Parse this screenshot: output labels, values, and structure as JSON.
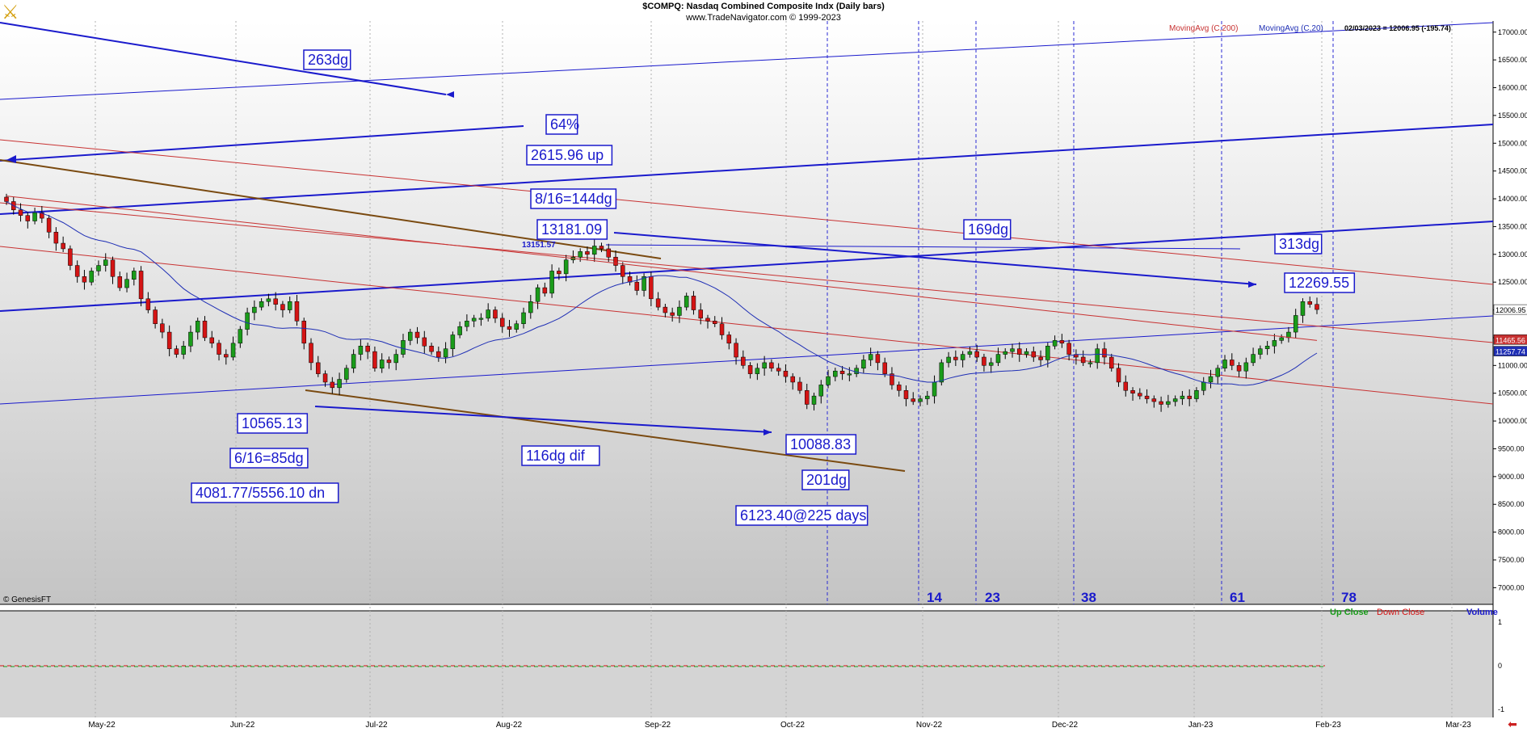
{
  "header": {
    "title": "$COMPQ:  Nasdaq Combined Composite Indx  (Daily bars)",
    "subtitle": "www.TradeNavigator.com © 1999-2023"
  },
  "indicator_legend": {
    "ma200_label": "MovingAvg (C,200)",
    "ma20_label": "MovingAvg (C,20)",
    "quote": "02/03/2023 = 12006.95 (-195.74)"
  },
  "watermark": "© GenesisFT",
  "volume_legend": {
    "up": "Up Close",
    "down": "Down Close",
    "volume": "Volume"
  },
  "colors": {
    "up": "#1a9c1a",
    "down": "#d41414",
    "ma20": "#1f2fb5",
    "ma200": "#c83232",
    "annotation": "#1a1acc",
    "brown": "#7a4a10",
    "panel_bg": "#d4d4d4"
  },
  "chart_data": {
    "type": "candlestick",
    "title": "$COMPQ:  Nasdaq Combined Composite Indx  (Daily bars)",
    "ylim": [
      6700,
      17200
    ],
    "price_ticks": [
      "17000.00",
      "16500.00",
      "16000.00",
      "15500.00",
      "15000.00",
      "14500.00",
      "14000.00",
      "13500.00",
      "13000.00",
      "12500.00",
      "12000.00",
      "11500.00",
      "11000.00",
      "10500.00",
      "10000.00",
      "9500.00",
      "9000.00",
      "8500.00",
      "8000.00",
      "7500.00",
      "7000.00"
    ],
    "x_ticks": [
      "May-22",
      "Jun-22",
      "Jul-22",
      "Aug-22",
      "Sep-22",
      "Oct-22",
      "Nov-22",
      "Dec-22",
      "Jan-23",
      "Feb-23",
      "Mar-23"
    ],
    "price_tags": [
      {
        "label": "12006.95",
        "value": 12006.95,
        "color": "#000000",
        "bg": "#ffffff"
      },
      {
        "label": "11465.56",
        "value": 11465.56,
        "color": "#ffffff",
        "bg": "#c83232"
      },
      {
        "label": "11257.74",
        "value": 11257.74,
        "color": "#ffffff",
        "bg": "#1f2fb5"
      }
    ],
    "volume_axis_ticks": [
      "1",
      "0",
      "-1"
    ],
    "candles_close_path": [
      13950,
      13800,
      13700,
      13600,
      13750,
      13650,
      13400,
      13200,
      13100,
      12800,
      12600,
      12500,
      12700,
      12800,
      12900,
      12600,
      12400,
      12550,
      12700,
      12200,
      12000,
      11750,
      11600,
      11300,
      11200,
      11350,
      11600,
      11800,
      11500,
      11400,
      11200,
      11150,
      11400,
      11650,
      11950,
      12050,
      12150,
      12200,
      12100,
      12000,
      12150,
      11800,
      11400,
      11050,
      10850,
      10700,
      10600,
      10750,
      10950,
      11200,
      11350,
      11250,
      10950,
      11100,
      11050,
      11200,
      11450,
      11600,
      11500,
      11350,
      11250,
      11150,
      11300,
      11550,
      11700,
      11800,
      11850,
      11850,
      12000,
      11850,
      11700,
      11650,
      11750,
      11950,
      12150,
      12400,
      12300,
      12700,
      12650,
      12900,
      12950,
      13050,
      13000,
      13150,
      13100,
      12950,
      12800,
      12600,
      12500,
      12350,
      12600,
      12200,
      12050,
      11950,
      11900,
      12050,
      12250,
      12000,
      11850,
      11800,
      11750,
      11550,
      11400,
      11150,
      11000,
      10850,
      10950,
      11050,
      10950,
      10900,
      10800,
      10700,
      10550,
      10300,
      10450,
      10650,
      10800,
      10900,
      10850,
      10850,
      10950,
      11100,
      11200,
      11050,
      10850,
      10650,
      10550,
      10400,
      10350,
      10400,
      10450,
      10700,
      11050,
      11150,
      11100,
      11200,
      11250,
      11150,
      11000,
      11050,
      11200,
      11250,
      11300,
      11200,
      11250,
      11150,
      11100,
      11350,
      11450,
      11400,
      11200,
      11150,
      11050,
      11050,
      11300,
      11150,
      10950,
      10700,
      10550,
      10500,
      10450,
      10400,
      10350,
      10300,
      10350,
      10400,
      10450,
      10400,
      10550,
      10700,
      10800,
      10950,
      11100,
      11000,
      10900,
      11050,
      11200,
      11300,
      11350,
      11450,
      11500,
      11600,
      11900,
      12150,
      12100,
      12006.95
    ],
    "series": [
      {
        "name": "MovingAvg (C,20)",
        "type": "line"
      },
      {
        "name": "MovingAvg (C,200)",
        "type": "line"
      }
    ],
    "annotations": [
      {
        "text": "263dg"
      },
      {
        "text": "64%"
      },
      {
        "text": "2615.96 up"
      },
      {
        "text": "8/16=144dg"
      },
      {
        "text": "13181.09"
      },
      {
        "text": "13151.57",
        "plain": true
      },
      {
        "text": "169dg"
      },
      {
        "text": "313dg"
      },
      {
        "text": "12269.55"
      },
      {
        "text": "10565.13"
      },
      {
        "text": "6/16=85dg"
      },
      {
        "text": "4081.77/5556.10 dn"
      },
      {
        "text": "116dg dif"
      },
      {
        "text": "10088.83"
      },
      {
        "text": "201dg"
      },
      {
        "text": "6123.40@225 days"
      }
    ],
    "cycle_counts": [
      "14",
      "23",
      "38",
      "61",
      "78"
    ]
  }
}
